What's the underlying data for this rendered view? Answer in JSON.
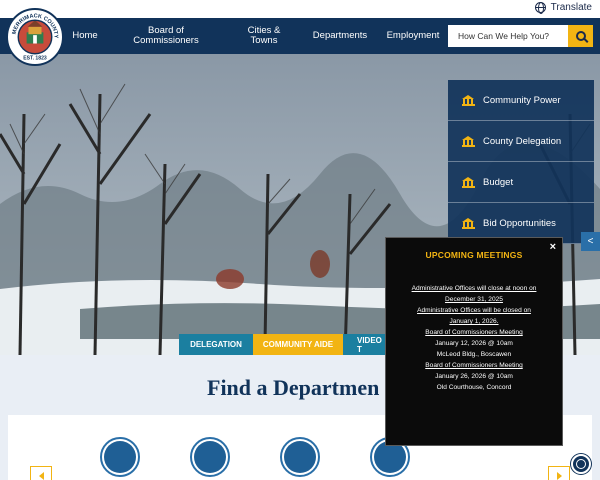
{
  "header": {
    "translate_label": "Translate",
    "seal_text": "MERRIMACK COUNTY NH",
    "seal_est": "EST. 1823"
  },
  "nav": {
    "items": [
      {
        "label": "Home"
      },
      {
        "label": "Board of Commissioners"
      },
      {
        "label": "Cities & Towns"
      },
      {
        "label": "Departments"
      },
      {
        "label": "Employment"
      }
    ],
    "search_placeholder": "How Can We Help You?"
  },
  "quick_links": [
    {
      "label": "Community Power"
    },
    {
      "label": "County Delegation"
    },
    {
      "label": "Budget"
    },
    {
      "label": "Bid Opportunities"
    }
  ],
  "tabs": [
    {
      "label": "DELEGATION"
    },
    {
      "label": "COMMUNITY AIDE"
    },
    {
      "label": "VIDEO T"
    }
  ],
  "main": {
    "find_title": "Find a Departmen"
  },
  "popup": {
    "close": "×",
    "title": "UPCOMING MEETINGS",
    "lines": [
      "Administrative Offices will close at noon on",
      "December 31, 2025",
      "Administrative Offices will be closed on",
      "January 1, 2026.",
      "Board of Commissioners Meeting",
      "January 12, 2026 @ 10am",
      "McLeod Bldg., Boscawen",
      "Board of Commissioners Meeting",
      "January 26, 2026 @ 10am",
      "Old Courthouse, Concord"
    ]
  },
  "icons": [
    "globe-icon",
    "search-icon",
    "bank-icon",
    "share-icon",
    "accessibility-icon",
    "chevron-left-icon",
    "chevron-right-icon"
  ],
  "colors": {
    "navy": "#11335a",
    "accent": "#f2b413",
    "teal": "#1b7fa0"
  }
}
